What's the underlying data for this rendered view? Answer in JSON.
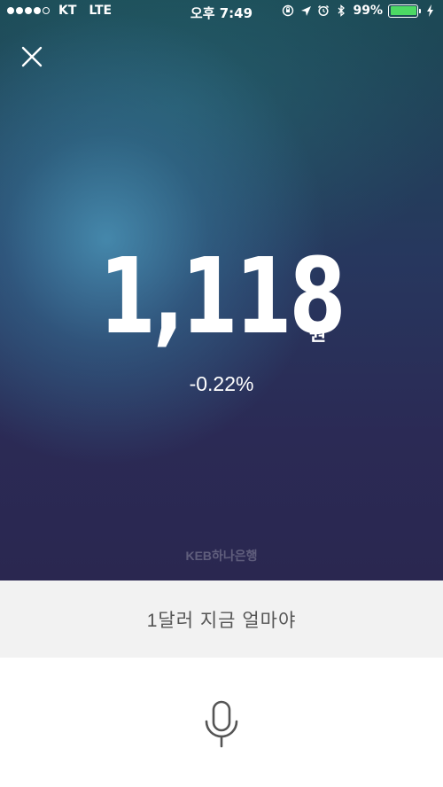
{
  "status_bar": {
    "carrier": "KT",
    "network": "LTE",
    "time": "오후 7:49",
    "battery_percent": "99%",
    "signal_bars_filled": 4,
    "signal_bars_total": 5
  },
  "rate": {
    "value": "1,118",
    "unit": "원",
    "change": "-0.22%"
  },
  "source_label": "KEB하나은행",
  "query": {
    "text": "1달러 지금 얼마야"
  },
  "icons": {
    "close": "close-icon",
    "mic": "microphone-icon",
    "location": "location-arrow-icon",
    "alarm": "alarm-icon",
    "bluetooth": "bluetooth-icon",
    "rotation_lock": "rotation-lock-icon",
    "charging": "charging-bolt-icon"
  },
  "colors": {
    "battery_fill": "#4cd964",
    "query_bg": "#f2f2f2",
    "hero_bottom": "#2a2750"
  }
}
